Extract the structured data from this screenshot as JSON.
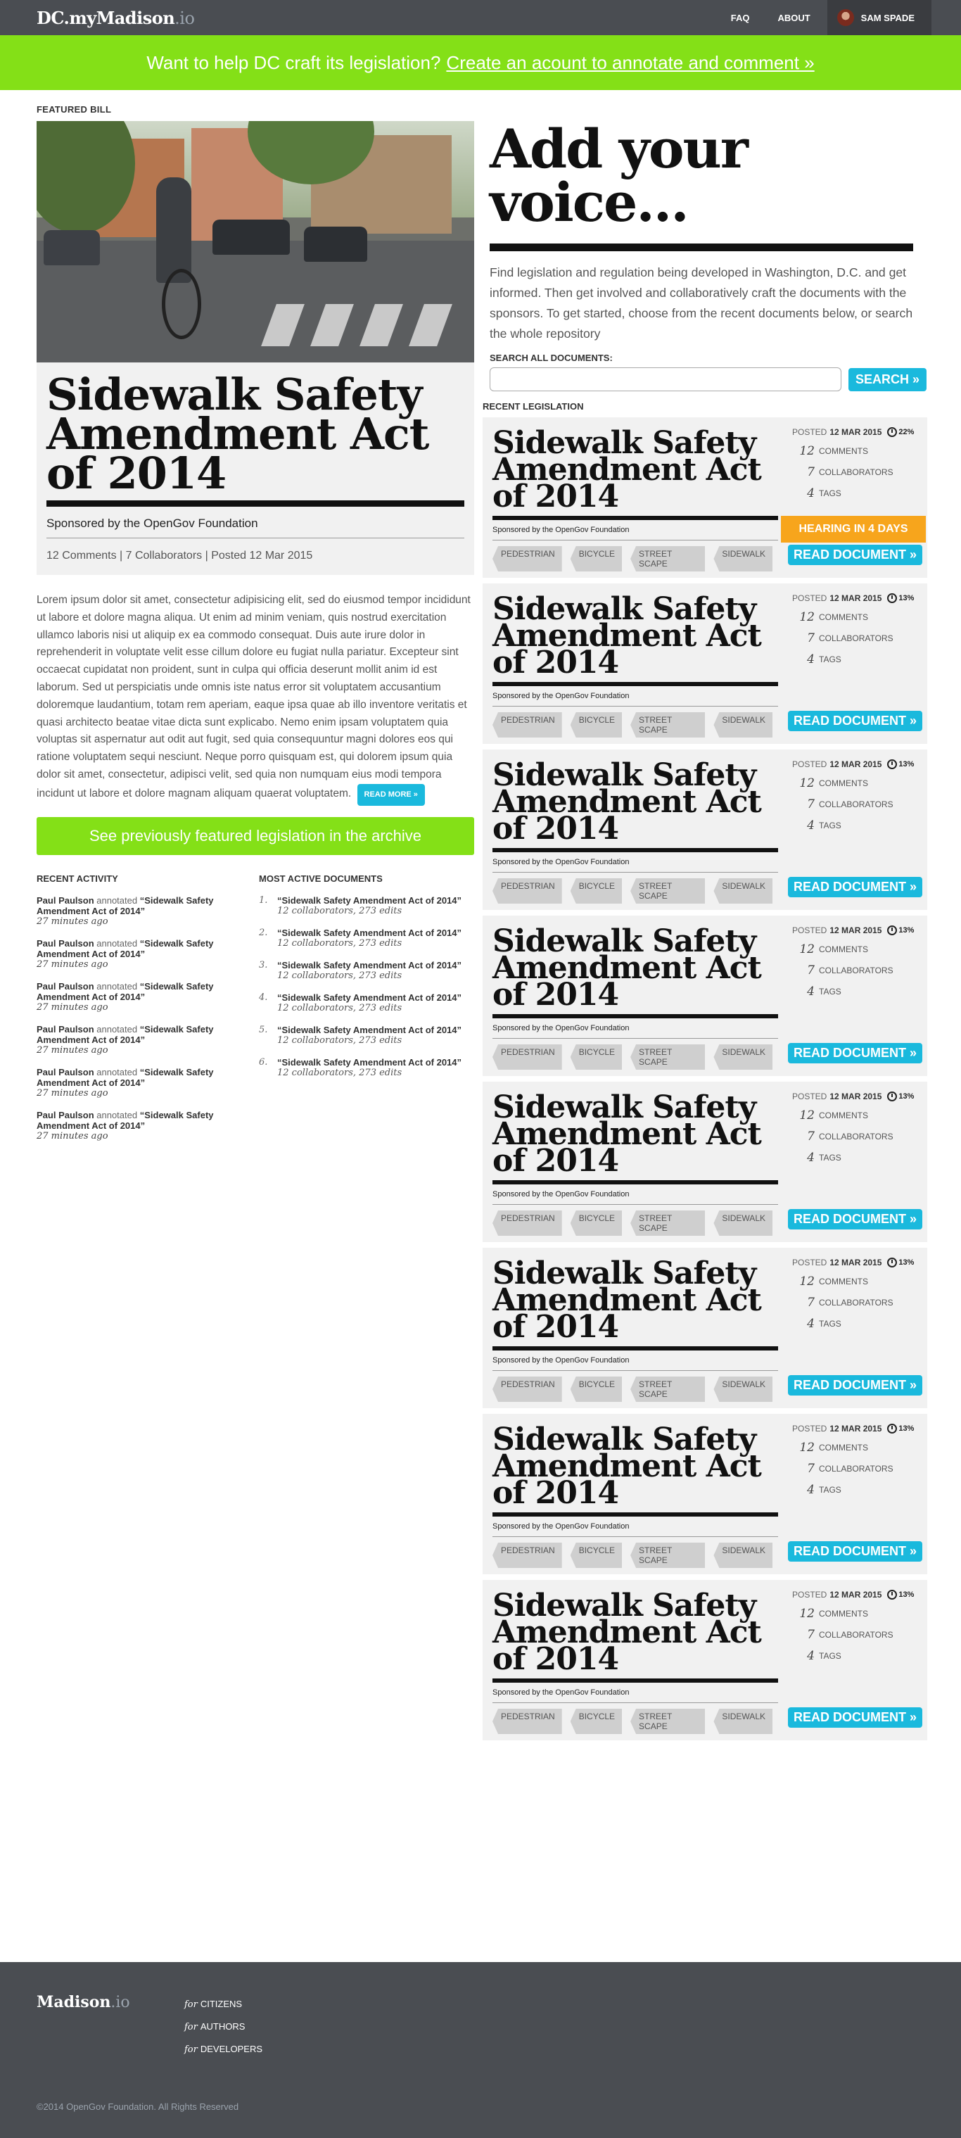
{
  "nav": {
    "logo_main": "DC.myMadison",
    "logo_suffix": ".io",
    "faq": "FAQ",
    "about": "ABOUT",
    "user": "SAM SPADE"
  },
  "banner": {
    "text": "Want to help DC craft its legislation?",
    "link": "Create an acount to annotate and comment »"
  },
  "featured": {
    "label": "FEATURED BILL",
    "title": "Sidewalk Safety Amendment Act of 2014",
    "sponsor": "Sponsored by the OpenGov Foundation",
    "meta": "12 Comments | 7 Collaborators | Posted 12 Mar 2015",
    "body": "Lorem ipsum dolor sit amet, consectetur adipisicing elit, sed do eiusmod tempor incididunt ut labore et dolore magna aliqua. Ut enim ad minim veniam, quis nos­trud exercitation ullamco laboris nisi ut aliquip ex ea commodo consequat. Duis aute irure dolor in reprehenderit in voluptate velit esse cillum dolore eu fugiat nulla pariatur. Excepteur sint occaecat cupidatat non proident, sunt in culpa qui officia deserunt mollit anim id est laborum. Sed ut perspiciatis unde omnis iste natus error sit voluptatem accusantium doloremque laudantium, totam rem aperiam, eaque ipsa quae ab illo inventore veritatis et quasi architecto beatae vitae dicta sunt explicabo. Nemo enim ipsam voluptatem quia voluptas sit aspernatur aut odit aut fugit, sed quia consequuntur magni dolores eos qui ratione voluptatem sequi nesciunt. Neque porro quisquam est, qui dolorem ipsum quia dolor sit amet, con­sectetur, adipisci velit, sed quia non numquam eius modi tempora incidunt ut labore et dolore magnam aliquam quaerat voluptatem.",
    "read_more": "READ MORE »",
    "archive_button": "See previously featured legislation in the archive"
  },
  "recent_activity": {
    "heading": "RECENT ACTIVITY",
    "items": [
      {
        "user": "Paul Paulson",
        "verb": "annotated",
        "doc": "“Sidewalk Safety Amendment Act of 2014”",
        "when": "27 minutes ago"
      },
      {
        "user": "Paul Paulson",
        "verb": "annotated",
        "doc": "“Sidewalk Safety Amendment Act of 2014”",
        "when": "27 minutes ago"
      },
      {
        "user": "Paul Paulson",
        "verb": "annotated",
        "doc": "“Sidewalk Safety Amendment Act of 2014”",
        "when": "27 minutes ago"
      },
      {
        "user": "Paul Paulson",
        "verb": "annotated",
        "doc": "“Sidewalk Safety Amendment Act of 2014”",
        "when": "27 minutes ago"
      },
      {
        "user": "Paul Paulson",
        "verb": "annotated",
        "doc": "“Sidewalk Safety Amendment Act of 2014”",
        "when": "27 minutes ago"
      },
      {
        "user": "Paul Paulson",
        "verb": "annotated",
        "doc": "“Sidewalk Safety Amendment Act of 2014”",
        "when": "27 minutes ago"
      }
    ]
  },
  "active_docs": {
    "heading": "MOST ACTIVE DOCUMENTS",
    "items": [
      {
        "num": "1.",
        "title": "“Sidewalk Safety Amendment Act of 2014”",
        "sub": "12 collaborators, 273 edits"
      },
      {
        "num": "2.",
        "title": "“Sidewalk Safety Amendment Act of 2014”",
        "sub": "12 collaborators, 273 edits"
      },
      {
        "num": "3.",
        "title": "“Sidewalk Safety Amendment Act of 2014”",
        "sub": "12 collaborators, 273 edits"
      },
      {
        "num": "4.",
        "title": "“Sidewalk Safety Amendment Act of 2014”",
        "sub": "12 collaborators, 273 edits"
      },
      {
        "num": "5.",
        "title": "“Sidewalk Safety Amendment Act of 2014”",
        "sub": "12 collaborators, 273 edits"
      },
      {
        "num": "6.",
        "title": "“Sidewalk Safety Amendment Act of 2014”",
        "sub": "12 collaborators, 273 edits"
      }
    ]
  },
  "hero": {
    "heading": "Add your voice...",
    "body": "Find legislation and regulation being developed in Washington, D.C. and get informed. Then get involved and collaboratively craft the documents with the sponsors. To get started, choose from the recent documents below, or search the whole repository",
    "search_label": "SEARCH ALL DOCUMENTS:",
    "search_placeholder": "",
    "search_button": "SEARCH »"
  },
  "recent_label": "RECENT LEGISLATION",
  "cards": [
    {
      "title": "Sidewalk Safety Amendment Act of 2014",
      "sponsor": "Sponsored by the OpenGov Foundation",
      "posted_label": "POSTED",
      "date": "12 MAR 2015",
      "pct": "22%",
      "comments": "12",
      "comments_label": "COMMENTS",
      "collaborators": "7",
      "collaborators_label": "COLLABORATORS",
      "tags_n": "4",
      "tags_label": "TAGS",
      "tags": [
        "PEDESTRIAN",
        "BICYCLE",
        "STREET SCAPE",
        "SIDEWALK"
      ],
      "hearing": "HEARING IN 4 DAYS",
      "read": "READ DOCUMENT »"
    },
    {
      "title": "Sidewalk Safety Amendment Act of 2014",
      "sponsor": "Sponsored by the OpenGov Foundation",
      "posted_label": "POSTED",
      "date": "12 MAR 2015",
      "pct": "13%",
      "comments": "12",
      "comments_label": "COMMENTS",
      "collaborators": "7",
      "collaborators_label": "COLLABORATORS",
      "tags_n": "4",
      "tags_label": "TAGS",
      "tags": [
        "PEDESTRIAN",
        "BICYCLE",
        "STREET SCAPE",
        "SIDEWALK"
      ],
      "read": "READ DOCUMENT »"
    },
    {
      "title": "Sidewalk Safety Amendment Act of 2014",
      "sponsor": "Sponsored by the OpenGov Foundation",
      "posted_label": "POSTED",
      "date": "12 MAR 2015",
      "pct": "13%",
      "comments": "12",
      "comments_label": "COMMENTS",
      "collaborators": "7",
      "collaborators_label": "COLLABORATORS",
      "tags_n": "4",
      "tags_label": "TAGS",
      "tags": [
        "PEDESTRIAN",
        "BICYCLE",
        "STREET SCAPE",
        "SIDEWALK"
      ],
      "read": "READ DOCUMENT »"
    },
    {
      "title": "Sidewalk Safety Amendment Act of 2014",
      "sponsor": "Sponsored by the OpenGov Foundation",
      "posted_label": "POSTED",
      "date": "12 MAR 2015",
      "pct": "13%",
      "comments": "12",
      "comments_label": "COMMENTS",
      "collaborators": "7",
      "collaborators_label": "COLLABORATORS",
      "tags_n": "4",
      "tags_label": "TAGS",
      "tags": [
        "PEDESTRIAN",
        "BICYCLE",
        "STREET SCAPE",
        "SIDEWALK"
      ],
      "read": "READ DOCUMENT »"
    },
    {
      "title": "Sidewalk Safety Amendment Act of 2014",
      "sponsor": "Sponsored by the OpenGov Foundation",
      "posted_label": "POSTED",
      "date": "12 MAR 2015",
      "pct": "13%",
      "comments": "12",
      "comments_label": "COMMENTS",
      "collaborators": "7",
      "collaborators_label": "COLLABORATORS",
      "tags_n": "4",
      "tags_label": "TAGS",
      "tags": [
        "PEDESTRIAN",
        "BICYCLE",
        "STREET SCAPE",
        "SIDEWALK"
      ],
      "read": "READ DOCUMENT »"
    },
    {
      "title": "Sidewalk Safety Amendment Act of 2014",
      "sponsor": "Sponsored by the OpenGov Foundation",
      "posted_label": "POSTED",
      "date": "12 MAR 2015",
      "pct": "13%",
      "comments": "12",
      "comments_label": "COMMENTS",
      "collaborators": "7",
      "collaborators_label": "COLLABORATORS",
      "tags_n": "4",
      "tags_label": "TAGS",
      "tags": [
        "PEDESTRIAN",
        "BICYCLE",
        "STREET SCAPE",
        "SIDEWALK"
      ],
      "read": "READ DOCUMENT »"
    },
    {
      "title": "Sidewalk Safety Amendment Act of 2014",
      "sponsor": "Sponsored by the OpenGov Foundation",
      "posted_label": "POSTED",
      "date": "12 MAR 2015",
      "pct": "13%",
      "comments": "12",
      "comments_label": "COMMENTS",
      "collaborators": "7",
      "collaborators_label": "COLLABORATORS",
      "tags_n": "4",
      "tags_label": "TAGS",
      "tags": [
        "PEDESTRIAN",
        "BICYCLE",
        "STREET SCAPE",
        "SIDEWALK"
      ],
      "read": "READ DOCUMENT »"
    },
    {
      "title": "Sidewalk Safety Amendment Act of 2014",
      "sponsor": "Sponsored by the OpenGov Foundation",
      "posted_label": "POSTED",
      "date": "12 MAR 2015",
      "pct": "13%",
      "comments": "12",
      "comments_label": "COMMENTS",
      "collaborators": "7",
      "collaborators_label": "COLLABORATORS",
      "tags_n": "4",
      "tags_label": "TAGS",
      "tags": [
        "PEDESTRIAN",
        "BICYCLE",
        "STREET SCAPE",
        "SIDEWALK"
      ],
      "read": "READ DOCUMENT »"
    }
  ],
  "footer": {
    "logo_main": "Madison",
    "logo_suffix": ".io",
    "links": [
      {
        "pre": "for",
        "label": "CITIZENS"
      },
      {
        "pre": "for",
        "label": "AUTHORS"
      },
      {
        "pre": "for",
        "label": "DEVELOPERS"
      }
    ],
    "copyright": "©2014 OpenGov Foundation. All Rights Reserved"
  },
  "colors": {
    "green": "#84e017",
    "blue": "#1ab9dd",
    "orange": "#f7a51c",
    "nav": "#4a4d52"
  }
}
